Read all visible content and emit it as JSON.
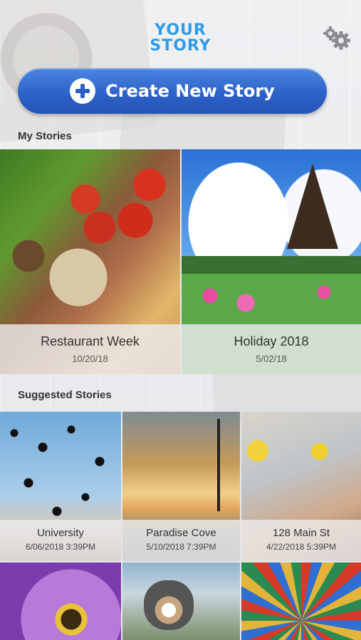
{
  "app": {
    "logo_line1": "YOUR",
    "logo_line2": "STORY"
  },
  "header": {
    "settings_icon": "gear-icon"
  },
  "create_button": {
    "label": "Create New Story",
    "icon": "plus-circle-icon"
  },
  "my_stories": {
    "title": "My Stories",
    "items": [
      {
        "title": "Restaurant Week",
        "date": "10/20/18"
      },
      {
        "title": "Holiday 2018",
        "date": "5/02/18"
      }
    ]
  },
  "suggested_stories": {
    "title": "Suggested Stories",
    "items": [
      {
        "title": "University",
        "date": "6/06/2018 3:39PM"
      },
      {
        "title": "Paradise Cove",
        "date": "5/10/2018 7:39PM"
      },
      {
        "title": "128 Main St",
        "date": "4/22/2018 5:39PM"
      }
    ]
  },
  "colors": {
    "accent": "#2f9be6",
    "button": "#2e62c8"
  }
}
